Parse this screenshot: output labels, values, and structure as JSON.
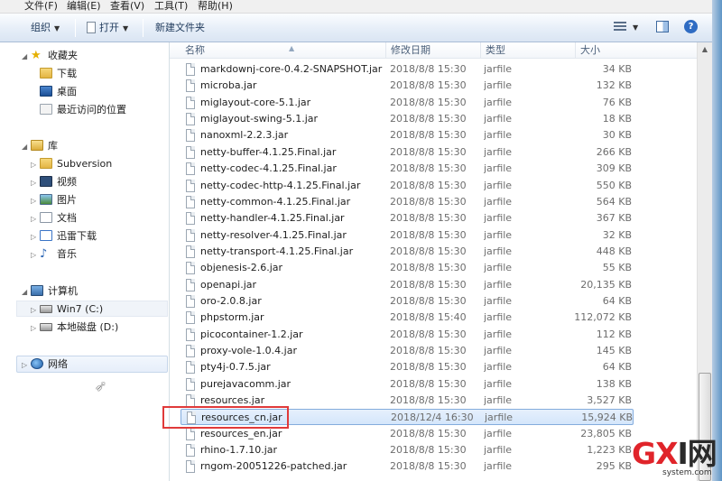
{
  "menubar": {
    "items": [
      "文件(F)",
      "编辑(E)",
      "查看(V)",
      "工具(T)",
      "帮助(H)"
    ]
  },
  "toolbar": {
    "organize": "组织",
    "open": "打开",
    "new_folder": "新建文件夹",
    "help_glyph": "?"
  },
  "nav": {
    "favorites": "收藏夹",
    "downloads": "下载",
    "desktop": "桌面",
    "recent": "最近访问的位置",
    "library": "库",
    "subversion": "Subversion",
    "videos": "视频",
    "pictures": "图片",
    "documents": "文档",
    "xunlei": "迅雷下载",
    "music": "音乐",
    "computer": "计算机",
    "drive_c": "Win7 (C:)",
    "drive_d": "本地磁盘 (D:)",
    "network": "网络"
  },
  "columns": {
    "name": "名称",
    "date": "修改日期",
    "type": "类型",
    "size": "大小"
  },
  "files": [
    {
      "name": "markdownj-core-0.4.2-SNAPSHOT.jar",
      "date": "2018/8/8 15:30",
      "type": "jarfile",
      "size": "34 KB"
    },
    {
      "name": "microba.jar",
      "date": "2018/8/8 15:30",
      "type": "jarfile",
      "size": "132 KB"
    },
    {
      "name": "miglayout-core-5.1.jar",
      "date": "2018/8/8 15:30",
      "type": "jarfile",
      "size": "76 KB"
    },
    {
      "name": "miglayout-swing-5.1.jar",
      "date": "2018/8/8 15:30",
      "type": "jarfile",
      "size": "18 KB"
    },
    {
      "name": "nanoxml-2.2.3.jar",
      "date": "2018/8/8 15:30",
      "type": "jarfile",
      "size": "30 KB"
    },
    {
      "name": "netty-buffer-4.1.25.Final.jar",
      "date": "2018/8/8 15:30",
      "type": "jarfile",
      "size": "266 KB"
    },
    {
      "name": "netty-codec-4.1.25.Final.jar",
      "date": "2018/8/8 15:30",
      "type": "jarfile",
      "size": "309 KB"
    },
    {
      "name": "netty-codec-http-4.1.25.Final.jar",
      "date": "2018/8/8 15:30",
      "type": "jarfile",
      "size": "550 KB"
    },
    {
      "name": "netty-common-4.1.25.Final.jar",
      "date": "2018/8/8 15:30",
      "type": "jarfile",
      "size": "564 KB"
    },
    {
      "name": "netty-handler-4.1.25.Final.jar",
      "date": "2018/8/8 15:30",
      "type": "jarfile",
      "size": "367 KB"
    },
    {
      "name": "netty-resolver-4.1.25.Final.jar",
      "date": "2018/8/8 15:30",
      "type": "jarfile",
      "size": "32 KB"
    },
    {
      "name": "netty-transport-4.1.25.Final.jar",
      "date": "2018/8/8 15:30",
      "type": "jarfile",
      "size": "448 KB"
    },
    {
      "name": "objenesis-2.6.jar",
      "date": "2018/8/8 15:30",
      "type": "jarfile",
      "size": "55 KB"
    },
    {
      "name": "openapi.jar",
      "date": "2018/8/8 15:30",
      "type": "jarfile",
      "size": "20,135 KB"
    },
    {
      "name": "oro-2.0.8.jar",
      "date": "2018/8/8 15:30",
      "type": "jarfile",
      "size": "64 KB"
    },
    {
      "name": "phpstorm.jar",
      "date": "2018/8/8 15:40",
      "type": "jarfile",
      "size": "112,072 KB"
    },
    {
      "name": "picocontainer-1.2.jar",
      "date": "2018/8/8 15:30",
      "type": "jarfile",
      "size": "112 KB"
    },
    {
      "name": "proxy-vole-1.0.4.jar",
      "date": "2018/8/8 15:30",
      "type": "jarfile",
      "size": "145 KB"
    },
    {
      "name": "pty4j-0.7.5.jar",
      "date": "2018/8/8 15:30",
      "type": "jarfile",
      "size": "64 KB"
    },
    {
      "name": "purejavacomm.jar",
      "date": "2018/8/8 15:30",
      "type": "jarfile",
      "size": "138 KB"
    },
    {
      "name": "resources.jar",
      "date": "2018/8/8 15:30",
      "type": "jarfile",
      "size": "3,527 KB"
    },
    {
      "name": "resources_cn.jar",
      "date": "2018/12/4 16:30",
      "type": "jarfile",
      "size": "15,924 KB",
      "selected": true
    },
    {
      "name": "resources_en.jar",
      "date": "2018/8/8 15:30",
      "type": "jarfile",
      "size": "23,805 KB"
    },
    {
      "name": "rhino-1.7.10.jar",
      "date": "2018/8/8 15:30",
      "type": "jarfile",
      "size": "1,223 KB"
    },
    {
      "name": "rngom-20051226-patched.jar",
      "date": "2018/8/8 15:30",
      "type": "jarfile",
      "size": "295 KB"
    }
  ],
  "watermark": {
    "brand_gx": "GX",
    "brand_rest": "I网",
    "domain": "system.com"
  },
  "colors": {
    "highlight_box": "#e03a3a",
    "selection": "#d4e6fb"
  }
}
